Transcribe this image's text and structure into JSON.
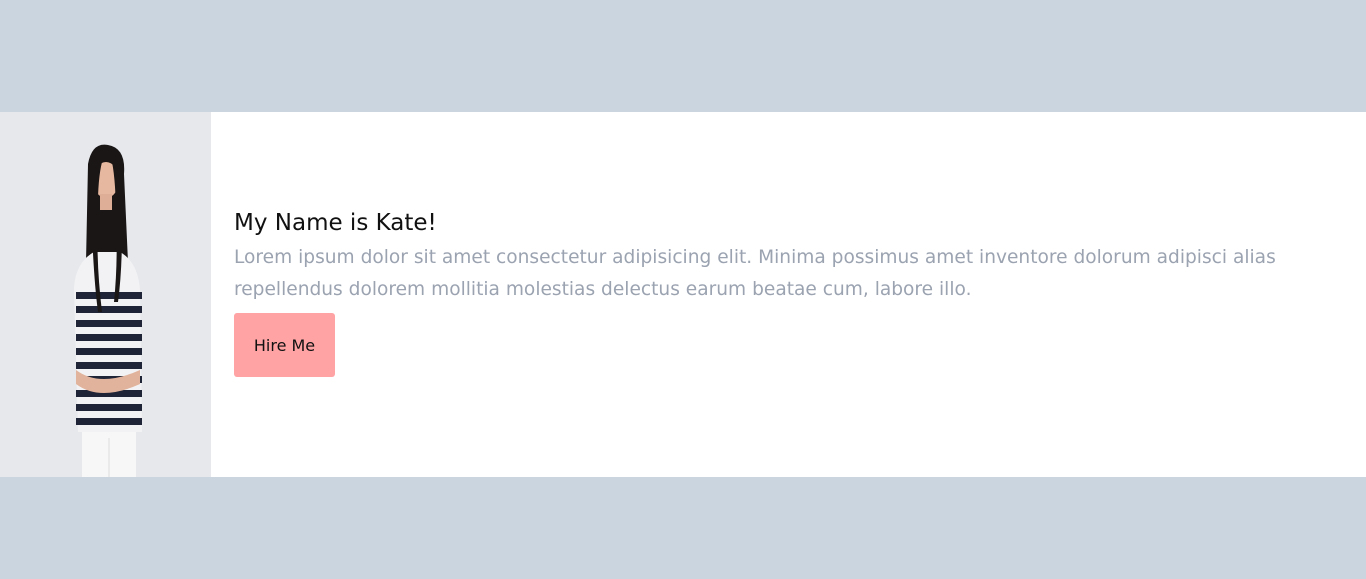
{
  "profile": {
    "heading": "My Name is Kate!",
    "bio": "Lorem ipsum dolor sit amet consectetur adipisicing elit. Minima possimus amet inventore dolorum adipisci alias repellendus dolorem mollitia molestias delectus earum beatae cum, labore illo.",
    "hire_button_label": "Hire Me"
  },
  "colors": {
    "page_background": "#cad5e0",
    "card_background": "#ffffff",
    "button_background": "#ffa3a5",
    "bio_text": "#9ba3b1"
  }
}
